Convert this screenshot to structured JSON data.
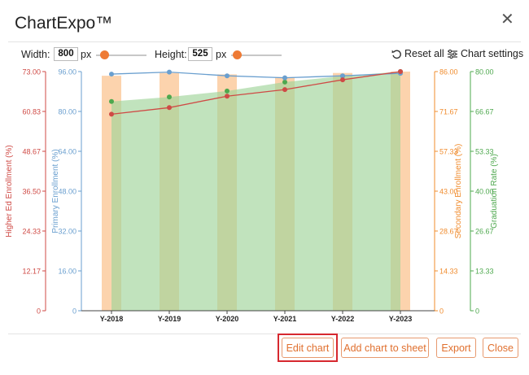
{
  "dialog": {
    "title": "ChartExpo™",
    "close_icon": "close-icon"
  },
  "toolbar": {
    "width_label": "Width:",
    "width_value": "800",
    "width_unit": "px",
    "height_label": "Height:",
    "height_value": "525",
    "height_unit": "px",
    "reset_label": "Reset all",
    "settings_label": "Chart settings"
  },
  "footer": {
    "edit_label": "Edit chart",
    "add_label": "Add chart to sheet",
    "export_label": "Export",
    "close_label": "Close"
  },
  "colors": {
    "higher_ed": "#cf4a45",
    "primary": "#6a9fcf",
    "secondary": "#f08c2e",
    "graduation": "#4ea84e",
    "bar_fill": "#fcd3ad",
    "area_fill": "#9fd49a"
  },
  "chart_data": {
    "type": "line",
    "categories": [
      "Y-2018",
      "Y-2019",
      "Y-2020",
      "Y-2021",
      "Y-2022",
      "Y-2023"
    ],
    "axes": [
      {
        "id": "higher_ed",
        "label": "Higher Ed Enrollment (%)",
        "min": 0,
        "max": 73,
        "ticks": [
          "0",
          "12.17",
          "24.33",
          "36.50",
          "48.67",
          "60.83",
          "73.00"
        ]
      },
      {
        "id": "primary",
        "label": "Primary Enrollment (%)",
        "min": 0,
        "max": 96,
        "ticks": [
          "0",
          "16.00",
          "32.00",
          "48.00",
          "64.00",
          "80.00",
          "96.00"
        ]
      },
      {
        "id": "secondary",
        "label": "Secondary Enrollment (%)",
        "min": 0,
        "max": 86,
        "ticks": [
          "0",
          "14.33",
          "28.67",
          "43.00",
          "57.33",
          "71.67",
          "86.00"
        ]
      },
      {
        "id": "graduation",
        "label": "Graduation Rate (%)",
        "min": 0,
        "max": 80,
        "ticks": [
          "0",
          "13.33",
          "26.67",
          "40.00",
          "53.33",
          "66.67",
          "80.00"
        ]
      }
    ],
    "series": [
      {
        "axis": "secondary",
        "kind": "bar",
        "values": [
          84.5,
          85.5,
          85.0,
          84.0,
          85.5,
          86.0
        ]
      },
      {
        "axis": "graduation",
        "kind": "area",
        "values": [
          70.0,
          71.5,
          73.5,
          76.5,
          78.5,
          80.0
        ]
      },
      {
        "axis": "primary",
        "kind": "line",
        "values": [
          95.0,
          95.8,
          94.3,
          93.5,
          94.3,
          95.3
        ]
      },
      {
        "axis": "higher_ed",
        "kind": "line",
        "values": [
          60.0,
          62.0,
          65.5,
          67.5,
          70.5,
          73.0
        ]
      }
    ]
  }
}
